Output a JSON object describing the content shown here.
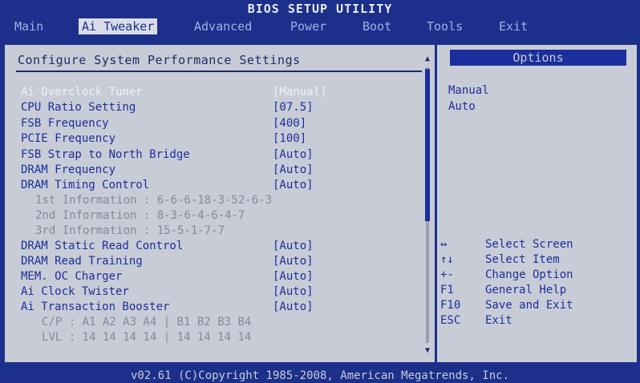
{
  "window": {
    "title": "BIOS SETUP UTILITY"
  },
  "menu": [
    {
      "label": "Main",
      "active": false
    },
    {
      "label": "Ai Tweaker",
      "active": true
    },
    {
      "label": "Advanced",
      "active": false
    },
    {
      "label": "Power",
      "active": false
    },
    {
      "label": "Boot",
      "active": false
    },
    {
      "label": "Tools",
      "active": false
    },
    {
      "label": "Exit",
      "active": false
    }
  ],
  "main": {
    "title": "Configure System Performance Settings",
    "settings": [
      {
        "label": "Ai Overclock Tuner",
        "value": "[Manual]"
      },
      {
        "label": "CPU Ratio Setting",
        "value": "[07.5]"
      },
      {
        "label": "FSB Frequency",
        "value": "[400]"
      },
      {
        "label": "PCIE Frequency",
        "value": "[100]"
      },
      {
        "label": "FSB Strap to North Bridge",
        "value": "[Auto]"
      },
      {
        "label": "DRAM Frequency",
        "value": "[Auto]"
      },
      {
        "label": "DRAM Timing Control",
        "value": "[Auto]"
      },
      {
        "label": "1st Information : 6-6-6-18-3-52-6-3",
        "value": ""
      },
      {
        "label": "2nd Information : 8-3-6-4-6-4-7",
        "value": ""
      },
      {
        "label": "3rd Information : 15-5-1-7-7",
        "value": ""
      },
      {
        "label": "DRAM Static Read Control",
        "value": "[Auto]"
      },
      {
        "label": "DRAM Read Training",
        "value": "[Auto]"
      },
      {
        "label": "MEM. OC Charger",
        "value": "[Auto]"
      },
      {
        "label": "Ai Clock Twister",
        "value": "[Auto]"
      },
      {
        "label": "Ai Transaction Booster",
        "value": "[Auto]"
      },
      {
        "label": "C/P : A1 A2 A3 A4 | B1 B2 B3 B4",
        "value": ""
      },
      {
        "label": "LVL : 14 14 14 14 | 14 14 14 14",
        "value": ""
      }
    ]
  },
  "side": {
    "header": "Options",
    "options": [
      "Manual",
      "Auto"
    ],
    "help": [
      {
        "key": "↔",
        "desc": "Select Screen"
      },
      {
        "key": "↑↓",
        "desc": "Select Item"
      },
      {
        "key": "+-",
        "desc": "Change Option"
      },
      {
        "key": "F1",
        "desc": "General Help"
      },
      {
        "key": "F10",
        "desc": "Save and Exit"
      },
      {
        "key": "ESC",
        "desc": "Exit"
      }
    ]
  },
  "footer": {
    "text": "v02.61 (C)Copyright 1985-2008, American Megatrends, Inc."
  },
  "colors": {
    "background": "#1c2f8a",
    "panel": "#c8ccd6",
    "text": "#1b2f9c",
    "selected_text": "#f0f2f8",
    "info_text": "#858a98"
  }
}
